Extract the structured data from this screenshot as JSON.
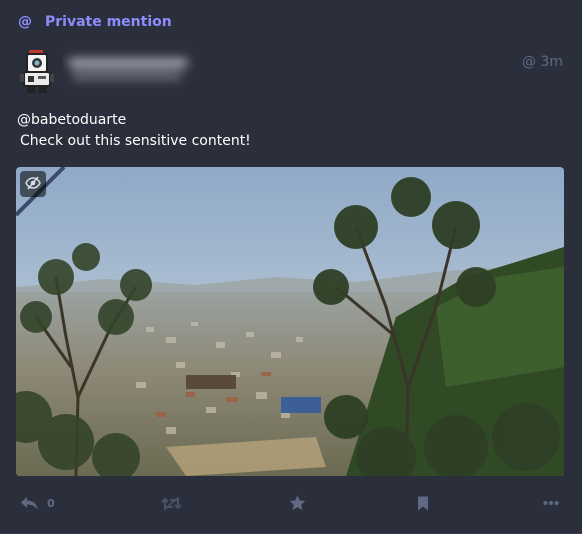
{
  "prepend": {
    "icon": "at-icon",
    "at_glyph": "@",
    "label": "Private mention",
    "color": "#8c8dff"
  },
  "status": {
    "time": "@ 3m",
    "mention": "@babetoduarte",
    "text": "Check out this sensitive content!"
  },
  "media": {
    "hide_icon": "eye-slash-icon"
  },
  "actions": {
    "reply_icon": "reply-icon",
    "reply_count": "0",
    "boost_icon": "boost-disabled-icon",
    "favourite_icon": "star-icon",
    "bookmark_icon": "bookmark-icon",
    "more_icon": "ellipsis-icon"
  },
  "colors": {
    "background": "#2b2f3c",
    "text": "#ffffff",
    "muted": "#606984",
    "accent": "#8c8dff"
  }
}
